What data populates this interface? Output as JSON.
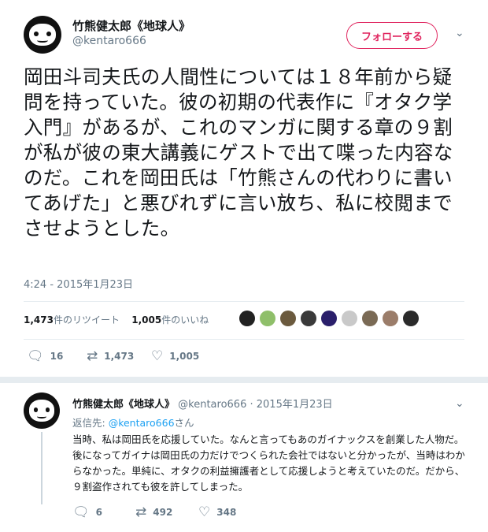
{
  "main_tweet": {
    "author_name": "竹熊健太郎《地球人》",
    "author_handle": "@kentaro666",
    "follow_label": "フォローする",
    "text": "岡田斗司夫氏の人間性については１８年前から疑問を持っていた。彼の初期の代表作に『オタク学入門』があるが、これのマンガに関する章の９割が私が彼の東大講義にゲストで出て喋った内容なのだ。これを岡田氏は「竹熊さんの代わりに書いてあげた」と悪びれずに言い放ち、私に校閲までさせようとした。",
    "timestamp": "4:24 - 2015年1月23日",
    "retweet_count": "1,473",
    "retweet_label": "件のリツイート",
    "like_count": "1,005",
    "like_label": "件のいいね",
    "liker_avatar_colors": [
      "#222222",
      "#8fbf6a",
      "#6b5a3e",
      "#3a3a3a",
      "#2a1f6b",
      "#c9c9c9",
      "#7a6a55",
      "#9b7d6a",
      "#2b2b2b"
    ],
    "actions": {
      "reply_count": "16",
      "retweet_count": "1,473",
      "like_count": "1,005"
    }
  },
  "reply_tweet": {
    "author_name": "竹熊健太郎《地球人》",
    "author_handle": "@kentaro666",
    "date": "· 2015年1月23日",
    "reply_to_prefix": "返信先: ",
    "reply_to_handle": "@kentaro666",
    "reply_to_suffix": "さん",
    "text": "当時、私は岡田氏を応援していた。なんと言ってもあのガイナックスを創業した人物だ。後になってガイナは岡田氏の力だけでつくられた会社ではないと分かったが、当時はわからなかった。単純に、オタクの利益擁護者として応援しようと考えていたのだ。だから、９割盗作されても彼を許してしまった。",
    "actions": {
      "reply_count": "6",
      "retweet_count": "492",
      "like_count": "348"
    }
  },
  "icons": {
    "chevron": "chevron-down-icon",
    "reply": "reply-icon",
    "retweet": "retweet-icon",
    "like": "heart-icon"
  }
}
